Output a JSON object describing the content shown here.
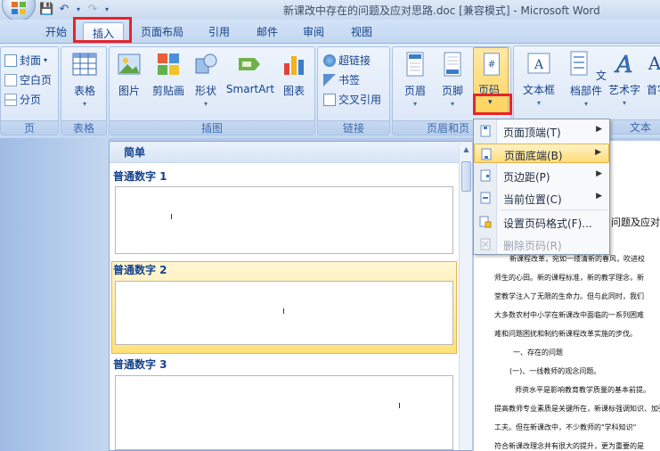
{
  "window": {
    "title": "新课改中存在的问题及应对思路.doc [兼容模式] - Microsoft Word"
  },
  "tabs": [
    {
      "label": "开始"
    },
    {
      "label": "插入"
    },
    {
      "label": "页面布局"
    },
    {
      "label": "引用"
    },
    {
      "label": "邮件"
    },
    {
      "label": "审阅"
    },
    {
      "label": "视图"
    }
  ],
  "ribbon": {
    "pages_group": {
      "label": "页",
      "cover": "封面",
      "blank": "空白页",
      "break": "分页"
    },
    "table_group": {
      "label": "表格",
      "table": "表格"
    },
    "illustrations_group": {
      "label": "插图",
      "picture": "图片",
      "clipart": "剪贴画",
      "shapes": "形状",
      "smartart": "SmartArt",
      "chart": "图表"
    },
    "links_group": {
      "label": "链接",
      "hyperlink": "超链接",
      "bookmark": "书签",
      "crossref": "交叉引用"
    },
    "header_footer_group": {
      "label": "页眉和页",
      "header": "页眉",
      "footer": "页脚",
      "page_number": "页码"
    },
    "text_group": {
      "label": "文本",
      "textbox": "文本框",
      "quickparts": "文档部件",
      "wordart": "艺术字",
      "dropcap": "首字"
    }
  },
  "gallery": {
    "header": "简单",
    "items": [
      {
        "label": "普通数字 1"
      },
      {
        "label": "普通数字 2"
      },
      {
        "label": "普通数字 3"
      }
    ]
  },
  "menu": {
    "items": [
      {
        "label": "页面顶端(T)",
        "has_submenu": true,
        "enabled": true
      },
      {
        "label": "页面底端(B)",
        "has_submenu": true,
        "enabled": true
      },
      {
        "label": "页边距(P)",
        "has_submenu": true,
        "enabled": true
      },
      {
        "label": "当前位置(C)",
        "has_submenu": true,
        "enabled": true
      },
      {
        "label": "设置页码格式(F)...",
        "has_submenu": false,
        "enabled": true
      },
      {
        "label": "删除页码(R)",
        "has_submenu": false,
        "enabled": false
      }
    ],
    "submenu_arrow": "▶"
  },
  "document": {
    "title_fragment": "问题及应对思",
    "lines": [
      "新课程改革，宛如一缕清新的春风，吹进校",
      "师生的心田。新的课程标准，新的教学理念，新",
      "堂教学注入了无限的生命力。但与此同时，我们",
      "大多数农村中小学在新课改中面临的一系列困难",
      "难和问题困扰和制约新课程改革实施的步伐。",
      "一、存在的问题",
      "(一)、一线教师的观念问题。",
      "师资水平是影响教育教学质量的基本前提。",
      "提高教师专业素质是关键所在，新课标强调知识、加强",
      "工夫。但在新课改中，不少教师的\"学科知识\"",
      "符合新课改理念并有很大的提升，更为重要的是"
    ]
  },
  "colors": {
    "accent_red": "#e8232a",
    "highlight": "#ffd45c",
    "ribbon_text": "#15428b"
  }
}
